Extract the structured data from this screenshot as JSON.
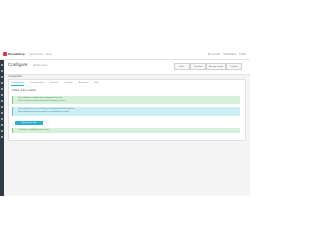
{
  "app": {
    "logo_text": "PrestaShop",
    "header_links": [
      "Quick Access",
      "Shop"
    ],
    "header_right": [
      "My account",
      "Notifications",
      "Profile"
    ]
  },
  "page": {
    "title": "Configure",
    "breadcrumb": "Module name",
    "buttons": [
      "Back",
      "Translate",
      "Manage hooks",
      "Disable"
    ]
  },
  "content": {
    "subtitle": "Configuration",
    "tabs": [
      "Configuration",
      "Customization",
      "Statistics",
      "Settings",
      "Advanced",
      "Help"
    ],
    "active_tab": 0,
    "section_title": "Status of the module",
    "alerts": [
      {
        "type": "success",
        "lines": [
          "The module is installed and configured correctly.",
          "Your account is linked and synchronization is active."
        ]
      },
      {
        "type": "info",
        "lines": [
          "Your catalog was successfully synchronized with the platform.",
          "Next automatic synchronization is scheduled for tonight."
        ]
      },
      {
        "type": "success",
        "lines": [
          "Tracking is enabled on your store."
        ]
      }
    ],
    "action_button": "Synchronize now"
  },
  "colors": {
    "accent": "#2bb0d4",
    "brand": "#d6334b",
    "sidebar": "#2f3a45",
    "success_bg": "#d7f0d9",
    "info_bg": "#cdeef5"
  }
}
